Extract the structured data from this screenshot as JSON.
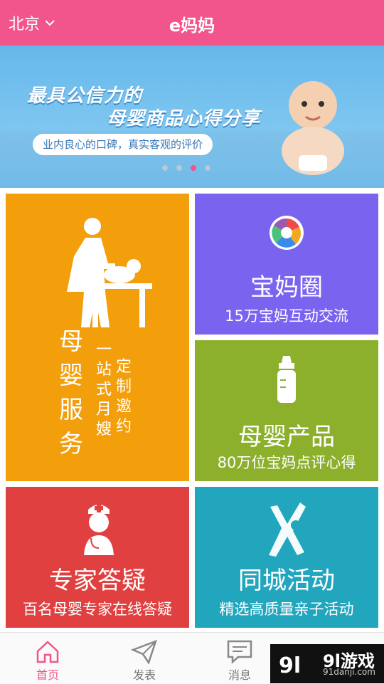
{
  "header": {
    "city": "北京",
    "title": "e妈妈",
    "city_dropdown_icon": "chevron-down-icon"
  },
  "banner": {
    "headline_1": "最具公信力的",
    "headline_2": "母婴商品心得分享",
    "tagline": "业内良心的口碑，真实客观的评价",
    "slides": 4,
    "active_slide": 3
  },
  "tiles": {
    "maternity": {
      "title": "母婴服务",
      "sub_1": "一站式月嫂",
      "sub_2": "定制邀约",
      "icon": "nanny-changing-baby-icon"
    },
    "circle": {
      "title": "宝妈圈",
      "sub": "15万宝妈互动交流",
      "icon": "color-wheel-icon"
    },
    "products": {
      "title": "母婴产品",
      "sub": "80万位宝妈点评心得",
      "icon": "baby-bottle-icon"
    },
    "experts": {
      "title": "专家答疑",
      "sub": "百名母婴专家在线答疑",
      "icon": "nurse-doctor-icon"
    },
    "events": {
      "title": "同城活动",
      "sub": "精选高质量亲子活动",
      "icon": "family-hands-icon"
    }
  },
  "tabbar": {
    "home": "首页",
    "post": "发表",
    "messages": "消息"
  },
  "watermark": {
    "logo": "9l游戏",
    "url": "91danji.com"
  },
  "colors": {
    "brand": "#f2558b",
    "orange": "#f39e0b",
    "purple": "#7a64ef",
    "green": "#8cb02c",
    "red": "#e0403f",
    "teal": "#22a6bd"
  }
}
